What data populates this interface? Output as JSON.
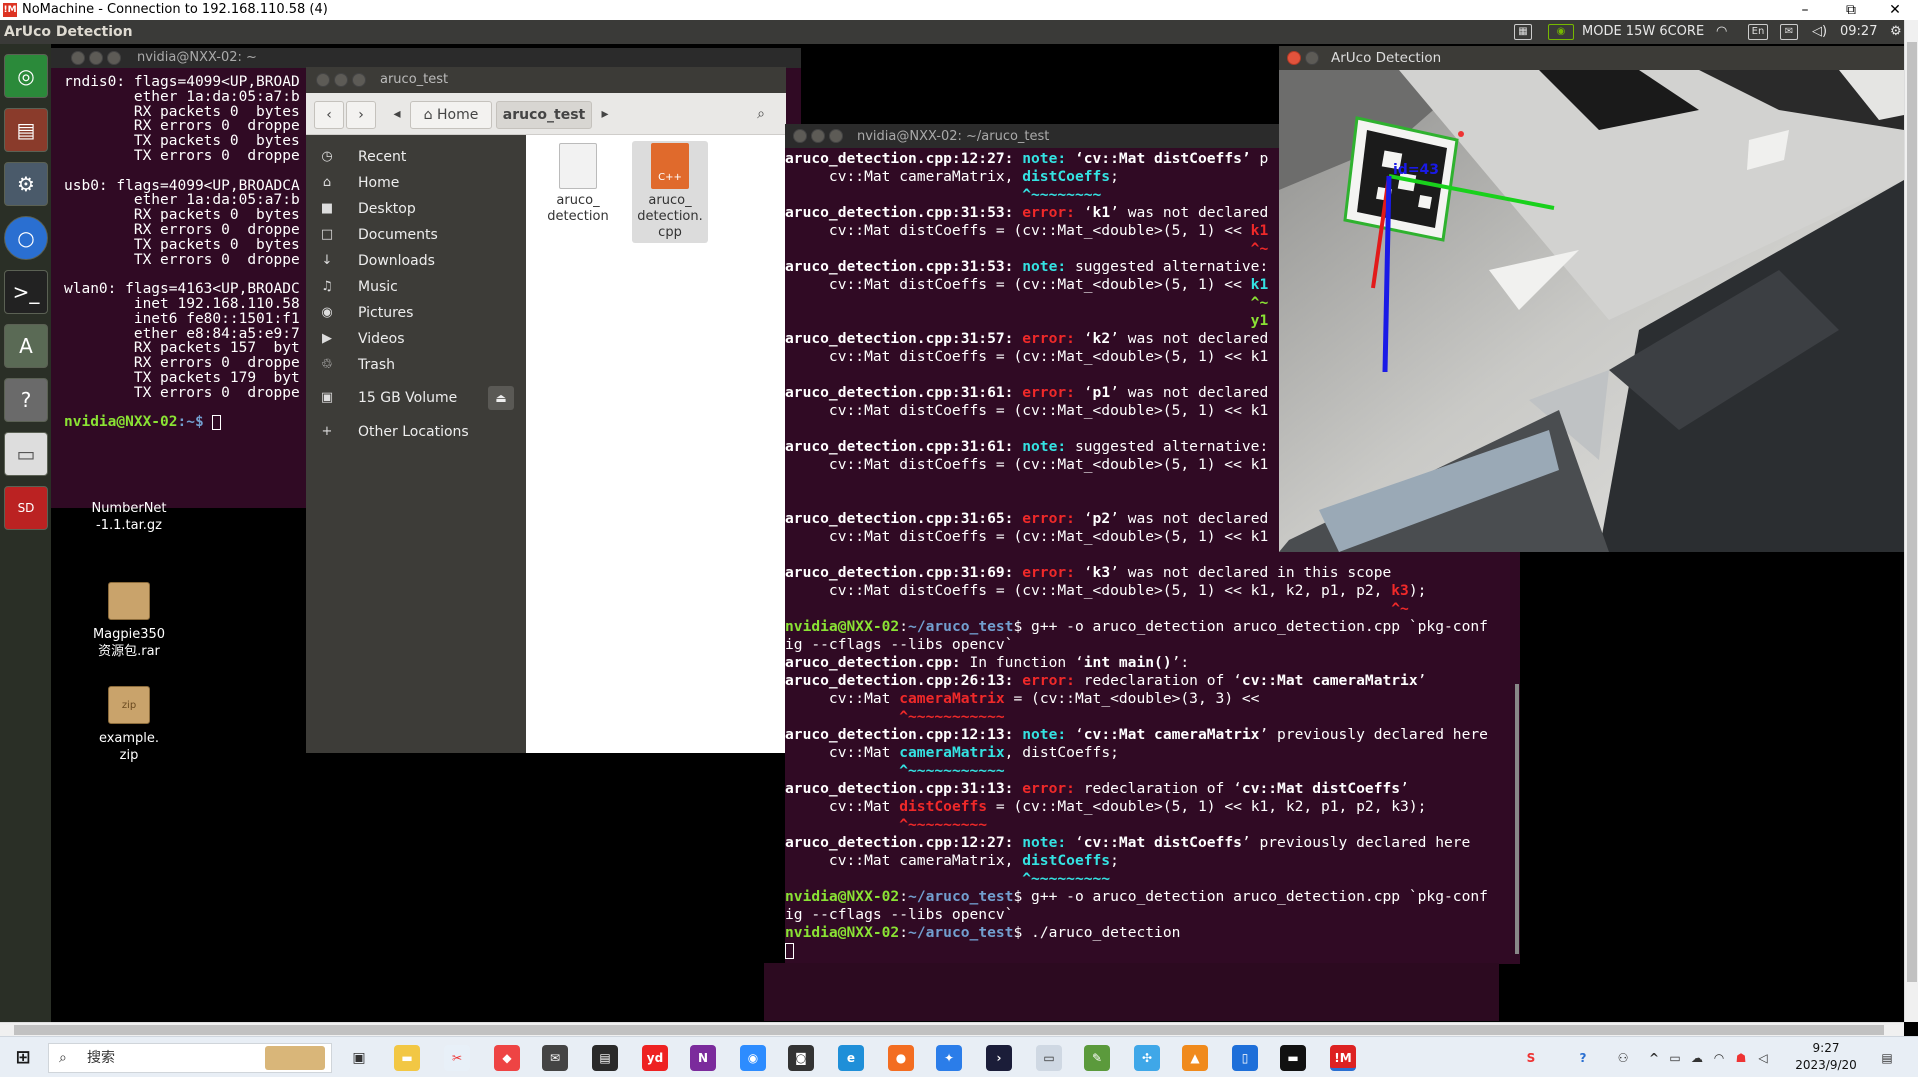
{
  "nomachine": {
    "title": "NoMachine - Connection to 192.168.110.58 (4)",
    "minimize": "–",
    "maximize": "⧉",
    "close": "✕"
  },
  "topbar": {
    "app_name": "ArUco Detection",
    "power_mode": "MODE 15W 6CORE",
    "language": "En",
    "time": "09:27"
  },
  "terminal1": {
    "title": "nvidia@NXX-02: ~",
    "lines": [
      "rndis0: flags=4099<UP,BROAD",
      "        ether 1a:da:05:a7:b",
      "        RX packets 0  bytes",
      "        RX errors 0  droppe",
      "        TX packets 0  bytes",
      "        TX errors 0  droppe",
      "",
      "usb0: flags=4099<UP,BROADCA",
      "        ether 1a:da:05:a7:b",
      "        RX packets 0  bytes",
      "        RX errors 0  droppe",
      "        TX packets 0  bytes",
      "        TX errors 0  droppe",
      "",
      "wlan0: flags=4163<UP,BROADC",
      "        inet 192.168.110.58",
      "        inet6 fe80::1501:f1",
      "        ether e8:84:a5:e9:7",
      "        RX packets 157  byt",
      "        RX errors 0  droppe",
      "        TX packets 179  byt",
      "        TX errors 0  droppe",
      ""
    ],
    "prompt_user": "nvidia@NXX-02",
    "prompt_path": ":~$ "
  },
  "desktop_icons": [
    {
      "label": "NumberNet\n-1.1.tar.gz"
    },
    {
      "label": "Magpie350\n资源包.rar"
    },
    {
      "label": "example.\nzip",
      "badge": "zip"
    }
  ],
  "file_manager": {
    "title": "aruco_test",
    "path_home": "Home",
    "path_current": "aruco_test",
    "sidebar": [
      {
        "icon": "◷",
        "label": "Recent"
      },
      {
        "icon": "⌂",
        "label": "Home"
      },
      {
        "icon": "■",
        "label": "Desktop"
      },
      {
        "icon": "□",
        "label": "Documents"
      },
      {
        "icon": "↓",
        "label": "Downloads"
      },
      {
        "icon": "♫",
        "label": "Music"
      },
      {
        "icon": "◉",
        "label": "Pictures"
      },
      {
        "icon": "▶",
        "label": "Videos"
      },
      {
        "icon": "♲",
        "label": "Trash"
      },
      {
        "icon": "▣",
        "label": "15 GB Volume"
      },
      {
        "icon": "+",
        "label": "Other Locations"
      }
    ],
    "files": [
      {
        "name": "aruco_\ndetection",
        "type": "binary"
      },
      {
        "name": "aruco_\ndetection.\ncpp",
        "type": "cpp",
        "badge": "C++"
      }
    ]
  },
  "terminal2": {
    "title": "nvidia@NXX-02: ~/aruco_test"
  },
  "aruco_window": {
    "title": "ArUco Detection",
    "marker_label": "id=43"
  },
  "taskbar": {
    "search_placeholder": "搜索",
    "time": "9:27",
    "date": "2023/9/20"
  }
}
